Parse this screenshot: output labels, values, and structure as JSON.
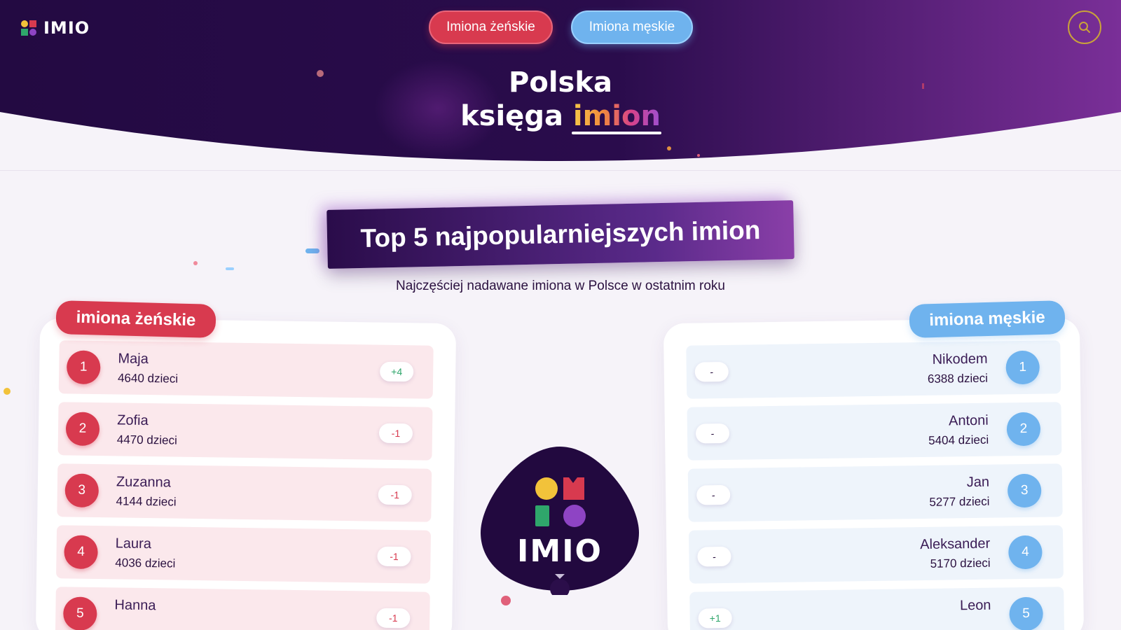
{
  "brand": {
    "name": "IMIO"
  },
  "nav": {
    "female_label": "Imiona żeńskie",
    "male_label": "Imiona męskie"
  },
  "hero": {
    "title_line1": "Polska",
    "title_line2_word": "księga",
    "title_accent": "imion"
  },
  "top5": {
    "heading": "Top 5 najpopularniejszych imion",
    "subtitle": "Najczęściej nadawane imiona w Polsce w ostatnim roku"
  },
  "female": {
    "tag": "imiona żeńskie",
    "items": [
      {
        "rank": "1",
        "name": "Maja",
        "count": "4640 dzieci",
        "change": "+4",
        "trend": "up"
      },
      {
        "rank": "2",
        "name": "Zofia",
        "count": "4470 dzieci",
        "change": "-1",
        "trend": "down"
      },
      {
        "rank": "3",
        "name": "Zuzanna",
        "count": "4144 dzieci",
        "change": "-1",
        "trend": "down"
      },
      {
        "rank": "4",
        "name": "Laura",
        "count": "4036 dzieci",
        "change": "-1",
        "trend": "down"
      },
      {
        "rank": "5",
        "name": "Hanna",
        "count": "",
        "change": "-1",
        "trend": "down"
      }
    ]
  },
  "male": {
    "tag": "imiona męskie",
    "items": [
      {
        "rank": "1",
        "name": "Nikodem",
        "count": "6388 dzieci",
        "change": "-",
        "trend": "same"
      },
      {
        "rank": "2",
        "name": "Antoni",
        "count": "5404 dzieci",
        "change": "-",
        "trend": "same"
      },
      {
        "rank": "3",
        "name": "Jan",
        "count": "5277 dzieci",
        "change": "-",
        "trend": "same"
      },
      {
        "rank": "4",
        "name": "Aleksander",
        "count": "5170 dzieci",
        "change": "-",
        "trend": "same"
      },
      {
        "rank": "5",
        "name": "Leon",
        "count": "",
        "change": "+1",
        "trend": "up"
      }
    ]
  },
  "center_logo": {
    "text": "IMIO"
  },
  "colors": {
    "header_bg": "#22093f",
    "female": "#d83a4f",
    "male": "#6fb3ee",
    "gold": "#c9a23a"
  }
}
